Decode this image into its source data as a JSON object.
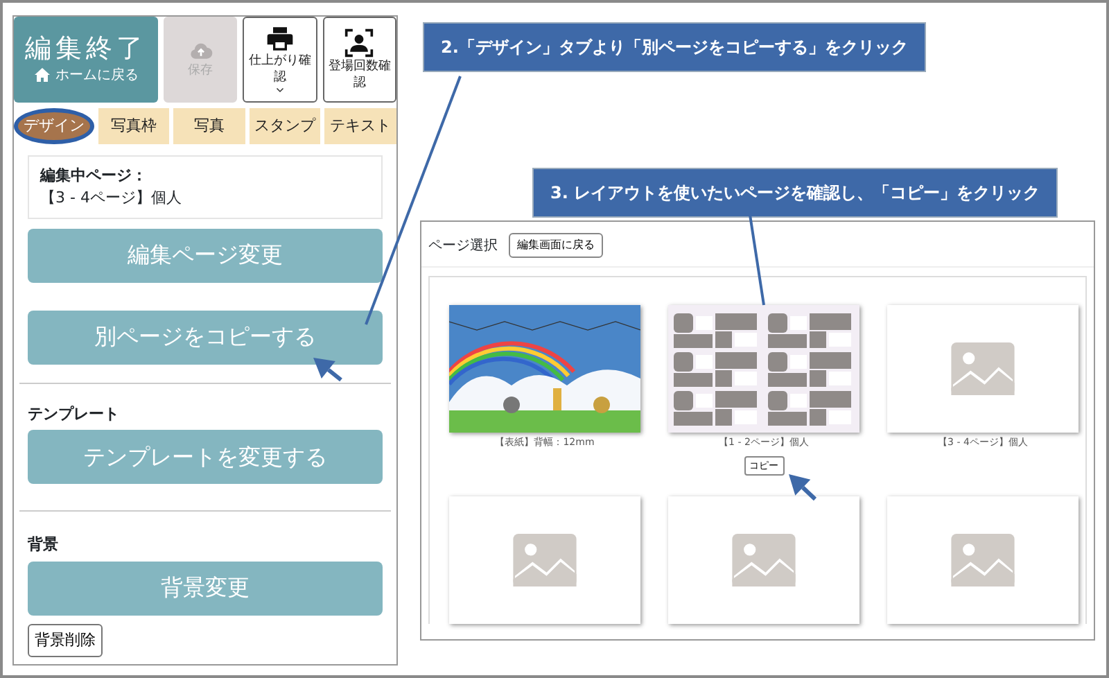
{
  "editor": {
    "finish_button": {
      "title": "編集終了",
      "subtitle": "ホームに戻る"
    },
    "toolbar": [
      {
        "label": "保存",
        "kind": "save",
        "disabled": true
      },
      {
        "label": "仕上がり確認",
        "kind": "print",
        "disabled": false
      },
      {
        "label": "登場回数確認",
        "kind": "person",
        "disabled": false
      }
    ],
    "tabs": [
      {
        "label": "デザイン",
        "selected": true
      },
      {
        "label": "写真枠",
        "selected": false
      },
      {
        "label": "写真",
        "selected": false
      },
      {
        "label": "スタンプ",
        "selected": false
      },
      {
        "label": "テキスト",
        "selected": false
      }
    ],
    "current_page": {
      "label": "編集中ページ：",
      "value": "【3 - 4ページ】個人"
    },
    "page_buttons": [
      "編集ページ変更",
      "別ページをコピーする"
    ],
    "template": {
      "heading": "テンプレート",
      "button": "テンプレートを変更する"
    },
    "background": {
      "heading": "背景",
      "button": "背景変更",
      "delete_button": "背景削除"
    }
  },
  "callouts": [
    {
      "text": "2.「デザイン」タブより「別ページをコピーする」をクリック"
    },
    {
      "text": "3. レイアウトを使いたいページを確認し、「コピー」をクリック"
    }
  ],
  "page_select": {
    "title": "ページ選択",
    "back_button": "編集画面に戻る",
    "pages": [
      {
        "kind": "cover",
        "caption": "【表紙】背幅：12mm"
      },
      {
        "kind": "spread",
        "caption": "【1 - 2ページ】個人",
        "copy_button": "コピー"
      },
      {
        "kind": "empty",
        "caption": "【3 - 4ページ】個人"
      },
      {
        "kind": "empty"
      },
      {
        "kind": "empty"
      },
      {
        "kind": "empty"
      }
    ]
  }
}
